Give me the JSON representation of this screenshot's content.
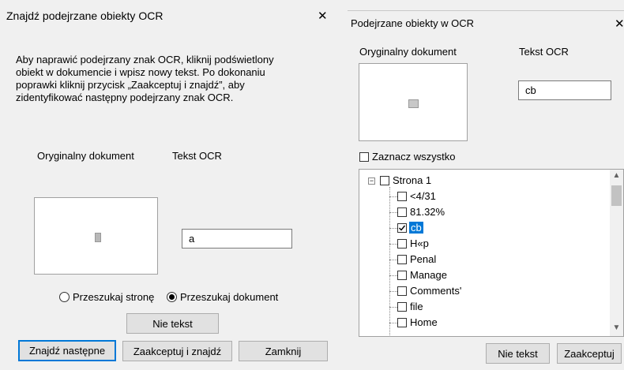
{
  "left_dialog": {
    "title": "Znajdź podejrzane obiekty OCR",
    "close_glyph": "✕",
    "instructions": [
      "Aby naprawić podejrzany znak OCR, kliknij podświetlony",
      "obiekt w dokumencie i wpisz nowy tekst. Po dokonaniu",
      "poprawki kliknij przycisk „Zaakceptuj i znajdź”, aby",
      "zidentyfikować następny podejrzany znak OCR."
    ],
    "original_label": "Oryginalny dokument",
    "ocr_label": "Tekst OCR",
    "ocr_value": "a",
    "radio_page": "Przeszukaj stronę",
    "radio_document": "Przeszukaj dokument",
    "radio_selected": "document",
    "not_text_button": "Nie tekst",
    "find_next_button": "Znajdź następne",
    "accept_find_button": "Zaakceptuj i znajdź",
    "close_button": "Zamknij"
  },
  "right_dialog": {
    "title": "Podejrzane obiekty w OCR",
    "close_glyph": "✕",
    "original_label": "Oryginalny dokument",
    "ocr_label": "Tekst OCR",
    "ocr_value": "cb",
    "select_all": "Zaznacz wszystko",
    "tree": {
      "root": "Strona 1",
      "items": [
        {
          "label": "<4/31",
          "checked": false,
          "selected": false
        },
        {
          "label": "81.32%",
          "checked": false,
          "selected": false
        },
        {
          "label": "cb",
          "checked": true,
          "selected": true
        },
        {
          "label": "H«p",
          "checked": false,
          "selected": false
        },
        {
          "label": "Penal",
          "checked": false,
          "selected": false
        },
        {
          "label": "Manage",
          "checked": false,
          "selected": false
        },
        {
          "label": "Comments'",
          "checked": false,
          "selected": false
        },
        {
          "label": "file",
          "checked": false,
          "selected": false
        },
        {
          "label": "Home",
          "checked": false,
          "selected": false
        }
      ]
    },
    "not_text_button": "Nie tekst",
    "accept_button": "Zaakceptuj"
  },
  "colors": {
    "accent": "#0078d7",
    "dialog_bg": "#f0f0f0",
    "button_bg": "#e1e1e1"
  }
}
